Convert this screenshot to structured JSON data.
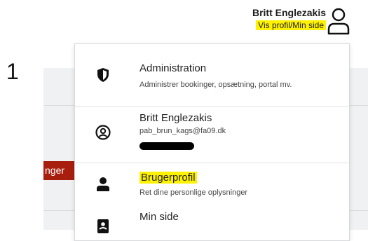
{
  "step_number": "1",
  "header": {
    "user_name": "Britt Englezakis",
    "profile_link": "Vis profil/Min side"
  },
  "background": {
    "button_fragment": "nger"
  },
  "menu": {
    "admin": {
      "title": "Administration",
      "desc": "Administrer bookinger, opsætning, portal mv."
    },
    "user": {
      "name": "Britt Englezakis",
      "email": "pab_brun_kags@fa09.dk"
    },
    "profile": {
      "title": "Brugerprofil",
      "desc": "Ret dine personlige oplysninger"
    },
    "my_page": {
      "title": "Min side"
    }
  },
  "colors": {
    "highlight": "#fff200",
    "red_button": "#a81e0e",
    "background_gray": "#eff1f2"
  },
  "icons": {
    "header": "user-outline-icon",
    "admin": "shield-icon",
    "user": "user-circle-icon",
    "profile": "person-icon",
    "my_page": "id-card-icon"
  }
}
